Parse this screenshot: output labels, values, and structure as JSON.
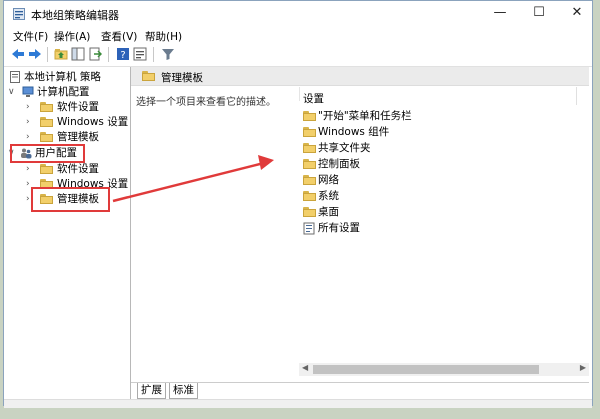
{
  "window": {
    "title": "本地组策略编辑器"
  },
  "menu": [
    "文件(F)",
    "操作(A)",
    "查看(V)",
    "帮助(H)"
  ],
  "tree": {
    "root": "本地计算机 策略",
    "computer": "计算机配置",
    "computer_children": [
      "软件设置",
      "Windows 设置",
      "管理模板"
    ],
    "user": "用户配置",
    "user_children": [
      "软件设置",
      "Windows 设置",
      "管理模板"
    ]
  },
  "right": {
    "header": "管理模板",
    "description": "选择一个项目来查看它的描述。",
    "column": "设置",
    "items": [
      "\"开始\"菜单和任务栏",
      "Windows 组件",
      "共享文件夹",
      "控制面板",
      "网络",
      "系统",
      "桌面",
      "所有设置"
    ]
  },
  "tabs": [
    "扩展",
    "标准"
  ],
  "colors": {
    "annotation": "#e03a3a",
    "folder": "#f2cf6a"
  }
}
